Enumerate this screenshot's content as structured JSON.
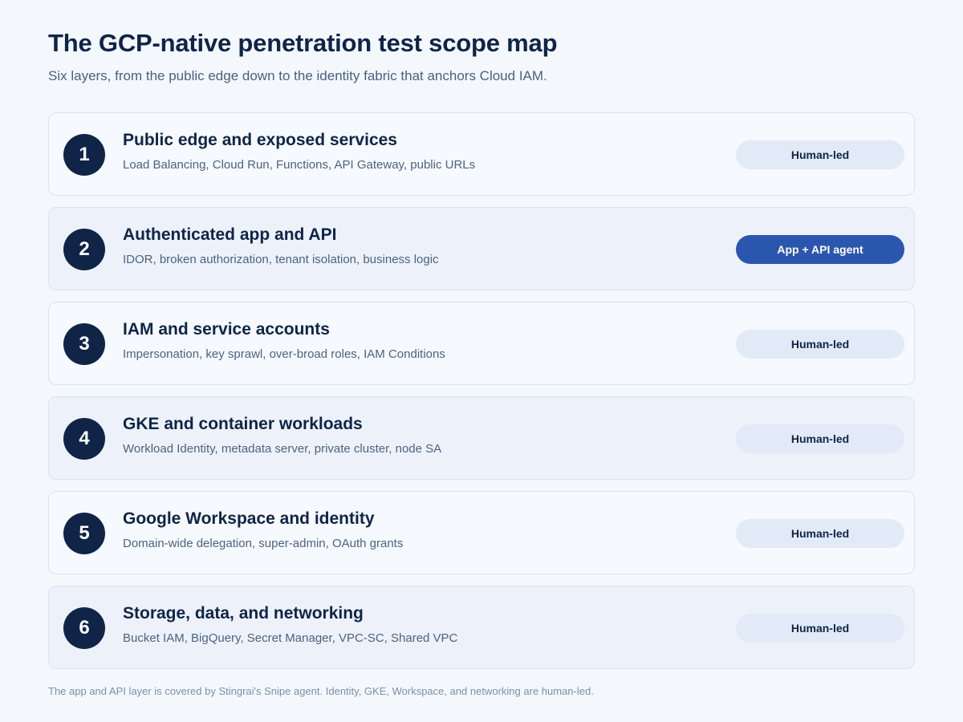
{
  "title": "The GCP-native penetration test scope map",
  "subtitle": "Six layers, from the public edge down to the identity fabric that anchors Cloud IAM.",
  "layers": [
    {
      "number": "1",
      "title": "Public edge and exposed services",
      "description": "Load Balancing, Cloud Run, Functions, API Gateway, public URLs",
      "badge": "Human-led"
    },
    {
      "number": "2",
      "title": "Authenticated app and API",
      "description": "IDOR, broken authorization, tenant isolation, business logic",
      "badge": "App + API agent"
    },
    {
      "number": "3",
      "title": "IAM and service accounts",
      "description": "Impersonation, key sprawl, over-broad roles, IAM Conditions",
      "badge": "Human-led"
    },
    {
      "number": "4",
      "title": "GKE and container workloads",
      "description": "Workload Identity, metadata server, private cluster, node SA",
      "badge": "Human-led"
    },
    {
      "number": "5",
      "title": "Google Workspace and identity",
      "description": "Domain-wide delegation, super-admin, OAuth grants",
      "badge": "Human-led"
    },
    {
      "number": "6",
      "title": "Storage, data, and networking",
      "description": "Bucket IAM, BigQuery, Secret Manager, VPC-SC, Shared VPC",
      "badge": "Human-led"
    }
  ],
  "footer": "The app and API layer is covered by Stingrai's Snipe agent. Identity, GKE, Workspace, and networking are human-led.",
  "colors": {
    "navy": "#0f2447",
    "agent_badge": "#2b56ad",
    "human_badge": "#e2eaf7",
    "background": "#f4f8fd"
  }
}
